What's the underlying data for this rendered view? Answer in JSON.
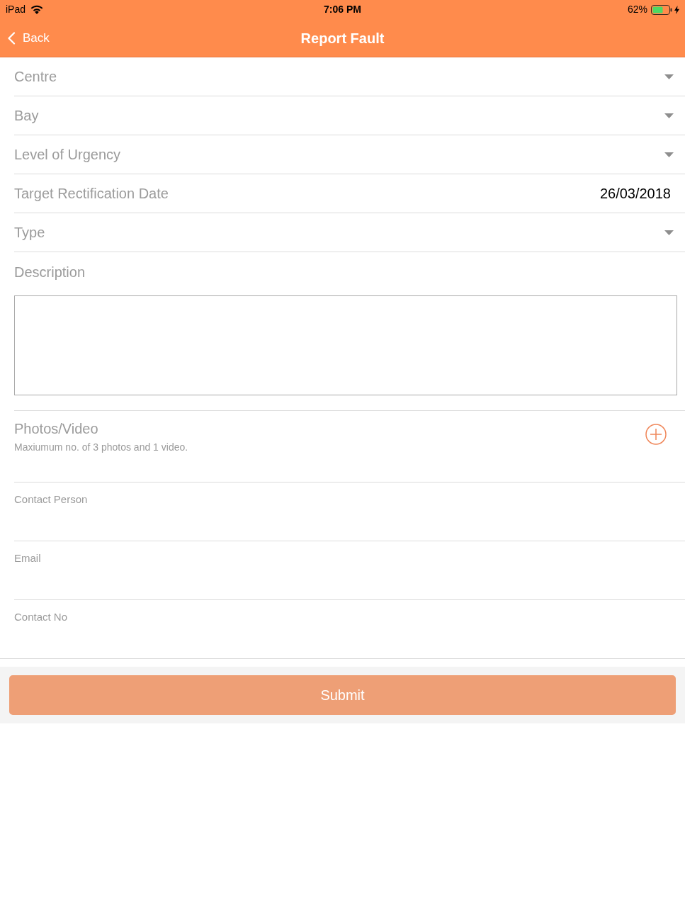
{
  "status_bar": {
    "device": "iPad",
    "time": "7:06 PM",
    "battery": "62%"
  },
  "nav_bar": {
    "back": "Back",
    "title": "Report Fault"
  },
  "fields": [
    {
      "kind": "select",
      "label": "Centre"
    },
    {
      "kind": "select",
      "label": "Bay"
    },
    {
      "kind": "select",
      "label": "Level of Urgency"
    },
    {
      "kind": "date",
      "label": "Target Rectification Date",
      "value": "26/03/2018"
    },
    {
      "kind": "select",
      "label": "Type"
    }
  ],
  "description": {
    "label": "Description"
  },
  "attachments": {
    "label": "Photos/Video",
    "hint": "Maxiumum no. of 3 photos and 1 video."
  },
  "contact_fields": [
    {
      "label": "Contact Person"
    },
    {
      "label": "Email"
    },
    {
      "label": "Contact No"
    }
  ],
  "submit": {
    "label": "Submit",
    "disabled": true
  }
}
